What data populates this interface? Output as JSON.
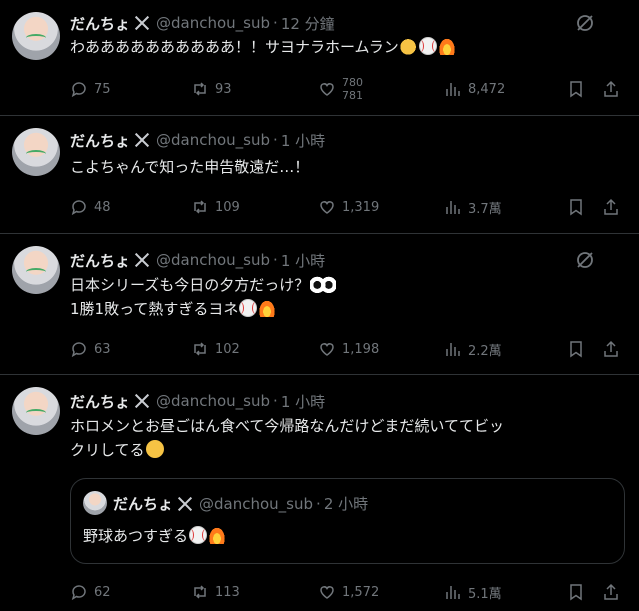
{
  "tweets": [
    {
      "name": "だんちょ",
      "handle": "@danchou_sub",
      "dot": "·",
      "time": "12 分鐘",
      "text": "わああああああああああ！！サヨナラホームラン",
      "emojis": [
        "clap",
        "baseball",
        "fire"
      ],
      "replies": "75",
      "retweets": "93",
      "likes": "780 781",
      "views": "8,472"
    },
    {
      "name": "だんちょ",
      "handle": "@danchou_sub",
      "dot": "·",
      "time": "1 小時",
      "text": "こよちゃんで知った申告敬遠だ…！",
      "replies": "48",
      "retweets": "109",
      "likes": "1,319",
      "views": "3.7萬"
    },
    {
      "name": "だんちょ",
      "handle": "@danchou_sub",
      "dot": "·",
      "time": "1 小時",
      "text_line1": "日本シリーズも今日の夕方だっけ？",
      "text_line2": "1勝1敗って熱すぎるヨネ",
      "emojis": [
        "eyes",
        "baseball",
        "fire"
      ],
      "replies": "63",
      "retweets": "102",
      "likes": "1,198",
      "views": "2.2萬"
    },
    {
      "name": "だんちょ",
      "handle": "@danchou_sub",
      "dot": "·",
      "time": "1 小時",
      "text_line1": "ホロメンとお昼ごはん食べて今帰路なんだけどまだ続いててビッ",
      "text_line2": "クリしてる",
      "emojis": [
        "laughing-tears"
      ],
      "quote": {
        "name": "だんちょ",
        "handle": "@danchou_sub",
        "dot": "·",
        "time": "2 小時",
        "text": "野球あつすぎる",
        "emojis": [
          "baseball",
          "fire"
        ]
      },
      "replies": "62",
      "retweets": "113",
      "likes": "1,572",
      "views": "5.1萬"
    }
  ],
  "icons": {
    "grok": "grok-icon",
    "reply": "reply-icon",
    "retweet": "retweet-icon",
    "like": "heart-icon",
    "views": "views-icon",
    "bookmark": "bookmark-icon",
    "share": "share-icon"
  },
  "colors": {
    "background": "#000000",
    "text": "#e7e9ea",
    "muted": "#71767b",
    "border": "#2f3336"
  }
}
